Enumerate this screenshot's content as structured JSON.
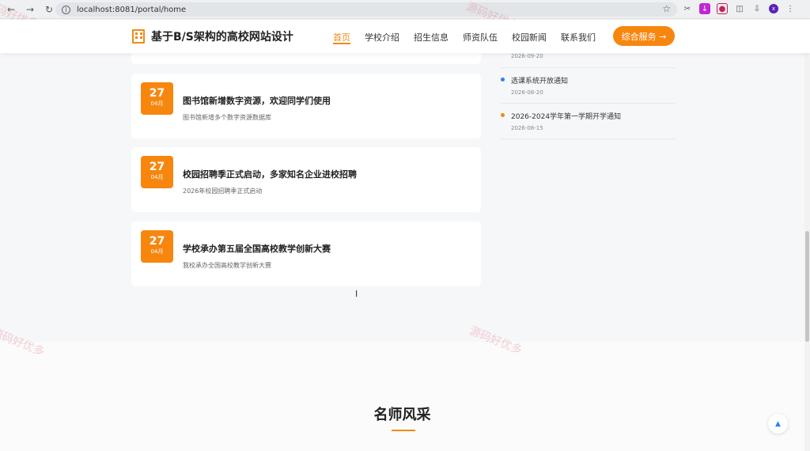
{
  "browser": {
    "url": "localhost:8081/portal/home",
    "avatar_letter": "x"
  },
  "header": {
    "site_title": "基于B/S架构的高校网站设计",
    "nav": [
      {
        "label": "首页",
        "active": true
      },
      {
        "label": "学校介绍"
      },
      {
        "label": "招生信息"
      },
      {
        "label": "师资队伍"
      },
      {
        "label": "校园新闻"
      },
      {
        "label": "联系我们"
      }
    ],
    "service_button": "综合服务 →"
  },
  "news": [
    {
      "day": "27",
      "month": "04月",
      "title": "图书馆新增数字资源，欢迎同学们使用",
      "desc": "图书馆新增多个数字资源数据库"
    },
    {
      "day": "27",
      "month": "04月",
      "title": "校园招聘季正式启动，多家知名企业进校招聘",
      "desc": "2026年校园招聘季正式启动"
    },
    {
      "day": "27",
      "month": "04月",
      "title": "学校承办第五届全国高校教学创新大赛",
      "desc": "我校承办全国高校教学创新大赛"
    }
  ],
  "notices": [
    {
      "title": "",
      "date": "2026-09-20"
    },
    {
      "title": "选课系统开放通知",
      "date": "2026-08-20",
      "dot_color": "#2d7ff9"
    },
    {
      "title": "2026-2024学年第一学期开学通知",
      "date": "2026-08-15",
      "dot_color": "#f08a12"
    }
  ],
  "section": {
    "title": "名师风采"
  },
  "watermark_text": "源码好优多",
  "colors": {
    "accent": "#f7860f",
    "blue": "#2d7ff9"
  }
}
